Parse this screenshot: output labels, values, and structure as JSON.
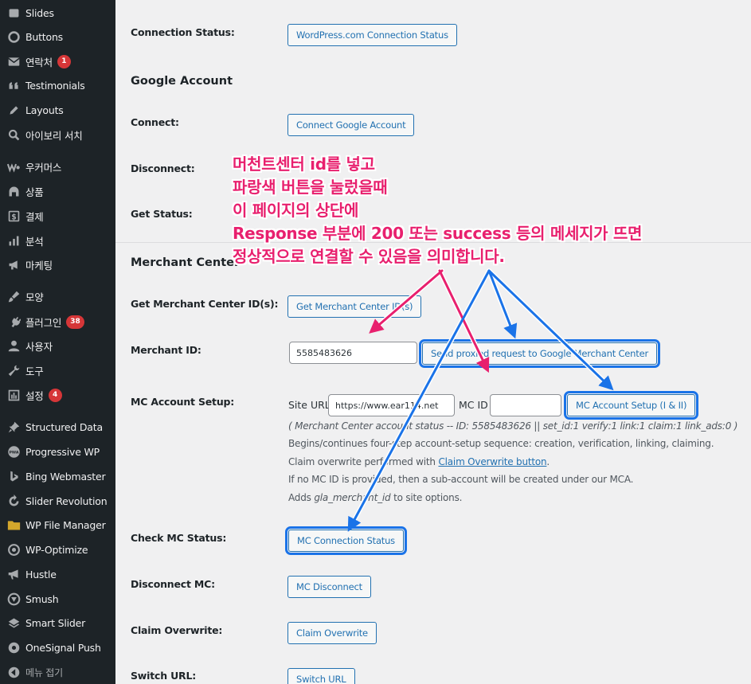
{
  "sidebar": {
    "items": [
      {
        "label": "Slides",
        "icon": "slides-icon"
      },
      {
        "label": "Buttons",
        "icon": "buttons-icon"
      },
      {
        "label": "연락처",
        "icon": "mail-icon",
        "badge": "1"
      },
      {
        "label": "Testimonials",
        "icon": "quote-icon"
      },
      {
        "label": "Layouts",
        "icon": "pencil-icon"
      },
      {
        "label": "아이보리 서치",
        "icon": "search-icon"
      },
      {
        "label": "우커머스",
        "icon": "woocommerce-icon"
      },
      {
        "label": "상품",
        "icon": "archive-icon"
      },
      {
        "label": "결제",
        "icon": "dollar-icon"
      },
      {
        "label": "분석",
        "icon": "bar-chart-icon"
      },
      {
        "label": "마케팅",
        "icon": "megaphone-icon"
      },
      {
        "label": "모양",
        "icon": "paintbrush-icon"
      },
      {
        "label": "플러그인",
        "icon": "plugin-icon",
        "badge": "38"
      },
      {
        "label": "사용자",
        "icon": "user-icon"
      },
      {
        "label": "도구",
        "icon": "wrench-icon"
      },
      {
        "label": "설정",
        "icon": "settings-icon",
        "badge": "4"
      },
      {
        "label": "Structured Data",
        "icon": "pin-icon"
      },
      {
        "label": "Progressive WP",
        "icon": "pwa-icon"
      },
      {
        "label": "Bing Webmaster",
        "icon": "bing-icon"
      },
      {
        "label": "Slider Revolution",
        "icon": "refresh-icon"
      },
      {
        "label": "WP File Manager",
        "icon": "folder-icon"
      },
      {
        "label": "WP-Optimize",
        "icon": "optimize-icon"
      },
      {
        "label": "Hustle",
        "icon": "megaphone-hustle-icon"
      },
      {
        "label": "Smush",
        "icon": "smush-icon"
      },
      {
        "label": "Smart Slider",
        "icon": "smart-slider-icon"
      },
      {
        "label": "OneSignal Push",
        "icon": "onesignal-icon"
      },
      {
        "label": "메뉴 접기",
        "icon": "collapse-icon"
      }
    ]
  },
  "main": {
    "connection_status_label": "Connection Status:",
    "wpcom_button": "WordPress.com Connection Status",
    "google_section_title": "Google Account",
    "connect_label": "Connect:",
    "connect_google_button": "Connect Google Account",
    "disconnect_label": "Disconnect:",
    "get_status_label": "Get Status:",
    "merchant_section_title": "Merchant Center",
    "get_mc_ids_label": "Get Merchant Center ID(s):",
    "get_mc_ids_button": "Get Merchant Center ID(s)",
    "merchant_id_label": "Merchant ID:",
    "merchant_id_value": "5585483626",
    "send_proxied_button": "Send proxied request to Google Merchant Center",
    "mc_account_setup_label": "MC Account Setup:",
    "site_url_label": "Site URL",
    "site_url_value": "https://www.ear114.net",
    "mc_id_label": "MC ID",
    "mc_id_value": "",
    "mc_account_setup_button": "MC Account Setup (I & II)",
    "account_status_line": "( Merchant Center account status -- ID: 5585483626 || set_id:1 verify:1 link:1 claim:1 link_ads:0 )",
    "desc_line1": "Begins/continues four-step account-setup sequence: creation, verification, linking, claiming.",
    "desc_line2_prefix": "Claim overwrite performed with",
    "desc_line2_link": "Claim Overwrite button",
    "desc_line2_suffix": ".",
    "desc_line3": "If no MC ID is provided, then a sub-account will be created under our MCA.",
    "desc_line4_prefix": "Adds",
    "desc_line4_code": "gla_merchant_id",
    "desc_line4_suffix": "to site options.",
    "check_mc_status_label": "Check MC Status:",
    "mc_connection_status_button": "MC Connection Status",
    "disconnect_mc_label": "Disconnect MC:",
    "mc_disconnect_button": "MC Disconnect",
    "claim_overwrite_label": "Claim Overwrite:",
    "claim_overwrite_button": "Claim Overwrite",
    "switch_url_label": "Switch URL:",
    "switch_url_button": "Switch URL"
  },
  "annotation": {
    "lines": [
      "머천트센터 id를 넣고",
      "파랑색 버튼을 눌렀을때",
      "이 페이지의 상단에",
      "Response 부분에 200 또는 success 등의 메세지가 뜨면",
      "정상적으로 연결할 수 있음을 의미합니다."
    ],
    "text_color": "#e8206e",
    "arrow_colors": [
      "#e8206e",
      "#1a73e8"
    ]
  },
  "colors": {
    "sidebar_bg": "#1d2327",
    "main_bg": "#f0f0f1",
    "button_accent": "#2271b1",
    "badge": "#d63638",
    "highlight": "#1a73e8"
  }
}
